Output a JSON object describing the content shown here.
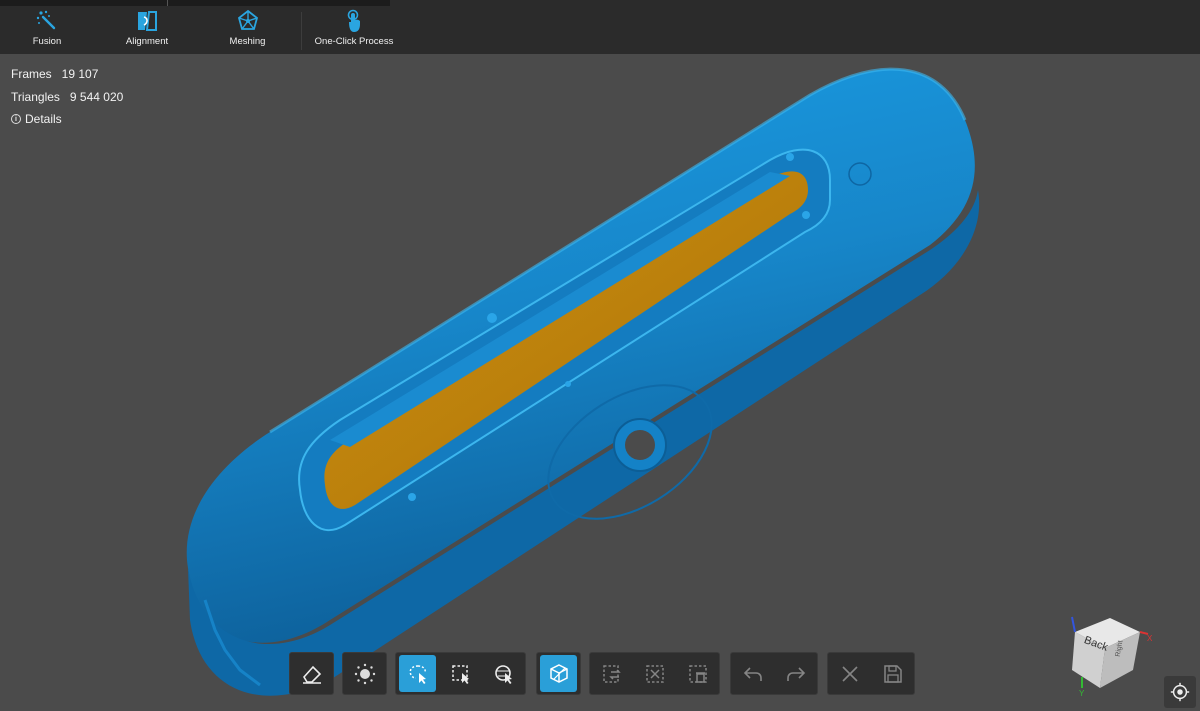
{
  "toolbar": {
    "fusion_label": "Fusion",
    "alignment_label": "Alignment",
    "meshing_label": "Meshing",
    "oneclick_label": "One-Click Process"
  },
  "stats": {
    "frames_label": "Frames",
    "frames_value": "19 107",
    "triangles_label": "Triangles",
    "triangles_value": "9 544 020",
    "details_label": "Details"
  },
  "viewcube": {
    "face_label": "Back",
    "side_label": "Right",
    "axis_x": "X",
    "axis_y": "Y"
  },
  "colors": {
    "accent": "#2a9fd8",
    "model_blue": "#1e8fd6",
    "model_inner": "#c98a12",
    "background": "#4b4b4b"
  }
}
